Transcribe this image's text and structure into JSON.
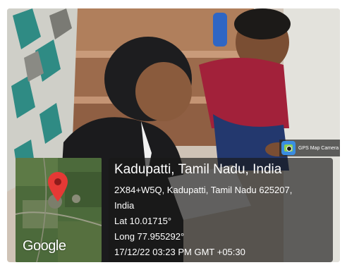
{
  "app_badge": {
    "label": "GPS Map Camera",
    "icon": "gps-map-camera-icon"
  },
  "location": {
    "place": "Kadupatti, Tamil Nadu, India",
    "address_line1": "2X84+W5Q, Kadupatti, Tamil Nadu 625207,",
    "address_line2": "India",
    "lat": "Lat 10.01715°",
    "long": "Long 77.955292°",
    "datetime": "17/12/22 03:23 PM GMT +05:30"
  },
  "map": {
    "logo_text": "Google",
    "pin_color": "#e53935"
  }
}
